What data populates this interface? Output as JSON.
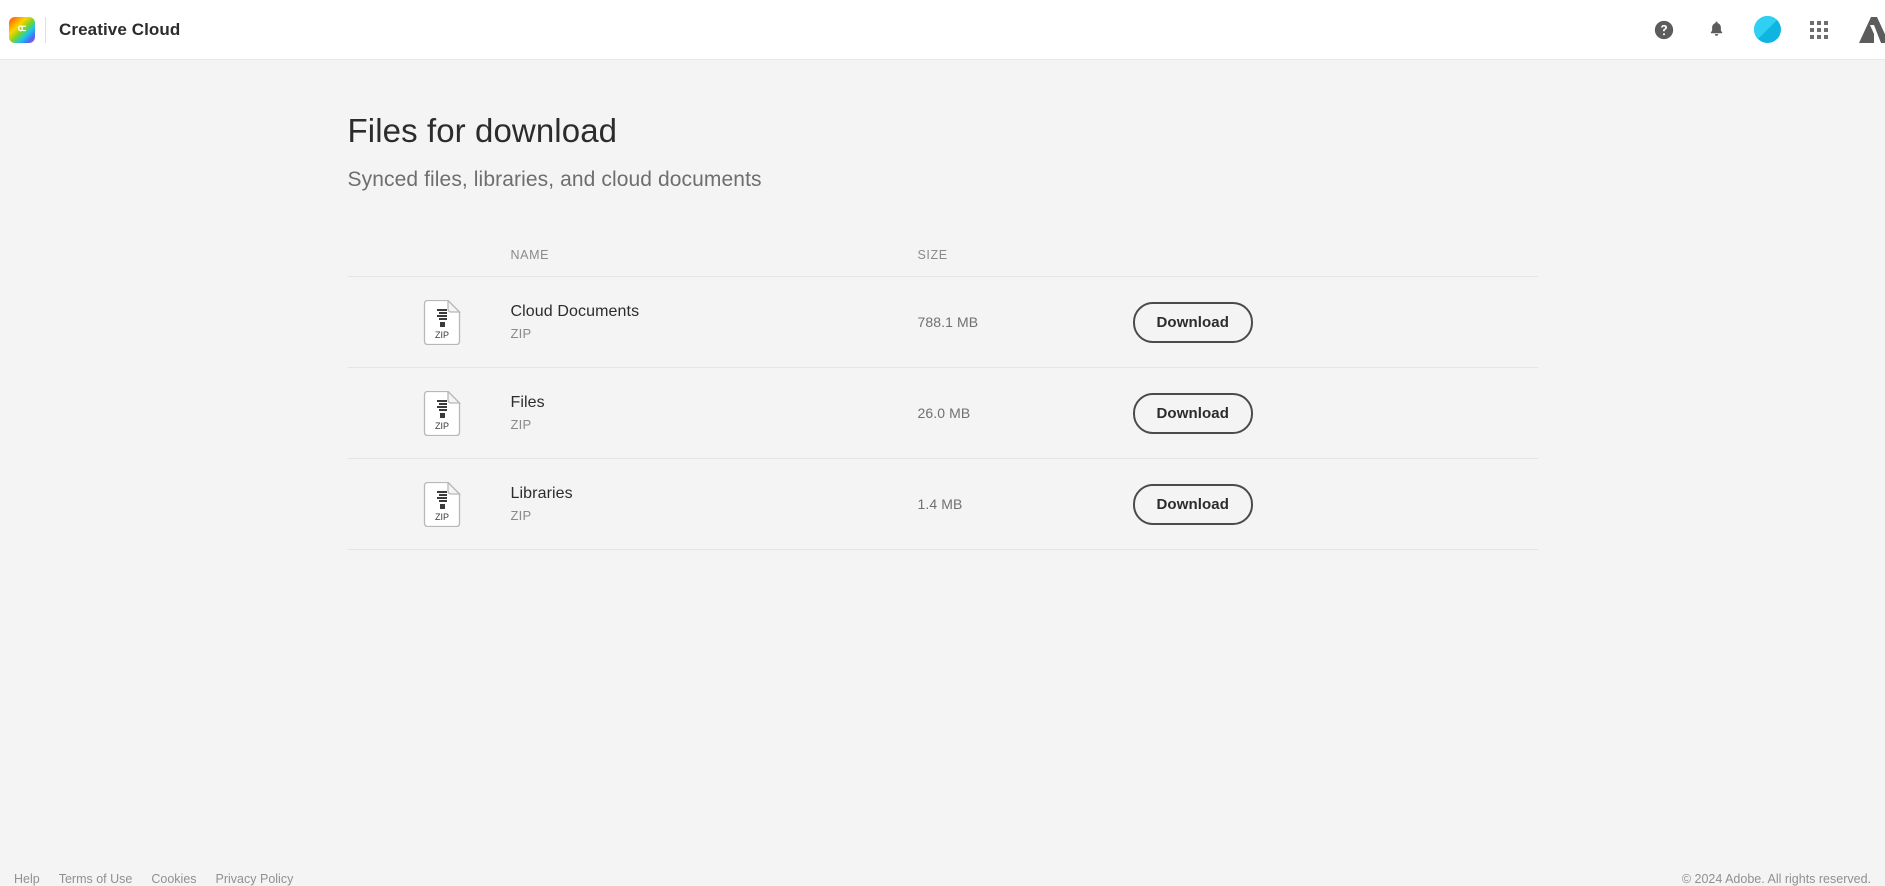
{
  "header": {
    "logo_icon": "creative-cloud-logo",
    "app_title": "Creative Cloud",
    "help_icon": "help-circle-icon",
    "notifications_icon": "bell-icon",
    "avatar_icon": "user-avatar",
    "app_grid_icon": "app-grid-icon",
    "adobe_logo_icon": "adobe-logo"
  },
  "main": {
    "title": "Files for download",
    "subtitle": "Synced files, libraries, and cloud documents",
    "table": {
      "columns": {
        "name": "NAME",
        "size": "SIZE"
      },
      "rows": [
        {
          "icon": "zip-file-icon",
          "icon_label": "ZIP",
          "name": "Cloud Documents",
          "type": "ZIP",
          "size": "788.1 MB",
          "action_label": "Download"
        },
        {
          "icon": "zip-file-icon",
          "icon_label": "ZIP",
          "name": "Files",
          "type": "ZIP",
          "size": "26.0 MB",
          "action_label": "Download"
        },
        {
          "icon": "zip-file-icon",
          "icon_label": "ZIP",
          "name": "Libraries",
          "type": "ZIP",
          "size": "1.4 MB",
          "action_label": "Download"
        }
      ]
    }
  },
  "footer": {
    "links": [
      "Help",
      "Terms of Use",
      "Cookies",
      "Privacy Policy"
    ],
    "copyright": "© 2024 Adobe. All rights reserved."
  },
  "colors": {
    "page_background": "#f4f4f4",
    "header_background": "#ffffff",
    "text_primary": "#2c2c2c",
    "text_secondary": "#6e6e6e",
    "text_muted": "#8a8a8a",
    "divider": "#e4e4e4",
    "avatar": "#0fb5e0"
  }
}
